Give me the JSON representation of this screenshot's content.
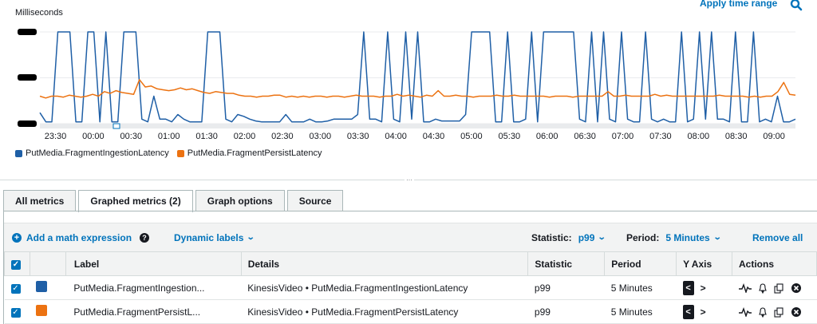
{
  "graph": {
    "y_title": "Milliseconds",
    "apply_time_range": "Apply time range",
    "x_ticks": [
      "23:30",
      "00:00",
      "00:30",
      "01:00",
      "01:30",
      "02:00",
      "02:30",
      "03:00",
      "03:30",
      "04:00",
      "04:30",
      "05:00",
      "05:30",
      "06:00",
      "06:30",
      "07:00",
      "07:30",
      "08:00",
      "08:30",
      "09:00"
    ],
    "accent_color": "#0073bb"
  },
  "chart_data": {
    "type": "line",
    "title": "",
    "ylabel": "Milliseconds",
    "xlabel": "",
    "ylim": [
      0,
      1
    ],
    "y_tick_labels_redacted": true,
    "x_tick_labels": [
      "23:30",
      "00:00",
      "00:30",
      "01:00",
      "01:30",
      "02:00",
      "02:30",
      "03:00",
      "03:30",
      "04:00",
      "04:30",
      "05:00",
      "05:30",
      "06:00",
      "06:30",
      "07:00",
      "07:30",
      "08:00",
      "08:30",
      "09:00"
    ],
    "grid": true,
    "legend_position": "bottom-left",
    "series": [
      {
        "name": "PutMedia.FragmentIngestionLatency",
        "color": "#1f5fa6",
        "values": [
          0.12,
          0.02,
          0.02,
          1.0,
          1.0,
          1.0,
          0.02,
          0.02,
          1.0,
          1.0,
          0.02,
          1.0,
          0.02,
          0.02,
          1.0,
          1.0,
          1.0,
          0.05,
          0.02,
          0.3,
          0.05,
          0.05,
          0.02,
          0.1,
          0.05,
          0.02,
          0.02,
          0.02,
          1.0,
          1.0,
          1.0,
          0.05,
          0.02,
          0.1,
          0.08,
          0.05,
          0.03,
          0.02,
          0.02,
          0.02,
          0.02,
          0.1,
          0.02,
          0.02,
          0.02,
          0.05,
          0.02,
          0.02,
          0.03,
          0.05,
          0.05,
          0.05,
          0.05,
          0.1,
          1.0,
          0.05,
          0.05,
          0.02,
          1.0,
          0.05,
          0.02,
          1.0,
          0.05,
          1.0,
          0.02,
          0.02,
          0.05,
          0.03,
          0.03,
          0.03,
          0.03,
          0.1,
          1.0,
          1.0,
          1.0,
          1.0,
          0.02,
          0.02,
          1.0,
          0.02,
          0.02,
          0.05,
          1.0,
          0.02,
          1.0,
          1.0,
          1.0,
          1.0,
          1.0,
          1.0,
          0.05,
          0.02,
          1.0,
          0.02,
          1.0,
          0.05,
          0.02,
          1.0,
          0.05,
          0.02,
          0.02,
          1.0,
          0.05,
          0.02,
          0.05,
          0.02,
          0.02,
          1.0,
          0.02,
          0.05,
          1.0,
          0.05,
          1.0,
          0.05,
          0.05,
          0.02,
          1.0,
          0.02,
          0.02,
          1.0,
          0.02,
          0.05,
          0.02,
          0.3,
          0.02,
          0.02,
          0.05
        ]
      },
      {
        "name": "PutMedia.FragmentPersistLatency",
        "color": "#ec7211",
        "values": [
          0.3,
          0.28,
          0.3,
          0.3,
          0.29,
          0.31,
          0.3,
          0.29,
          0.3,
          0.32,
          0.3,
          0.35,
          0.33,
          0.36,
          0.34,
          0.33,
          0.32,
          0.48,
          0.4,
          0.41,
          0.38,
          0.37,
          0.36,
          0.37,
          0.39,
          0.37,
          0.38,
          0.36,
          0.34,
          0.33,
          0.35,
          0.34,
          0.33,
          0.33,
          0.31,
          0.3,
          0.3,
          0.29,
          0.3,
          0.3,
          0.31,
          0.31,
          0.29,
          0.3,
          0.29,
          0.3,
          0.29,
          0.3,
          0.3,
          0.29,
          0.3,
          0.3,
          0.29,
          0.3,
          0.31,
          0.3,
          0.3,
          0.3,
          0.29,
          0.3,
          0.3,
          0.32,
          0.3,
          0.31,
          0.3,
          0.29,
          0.31,
          0.3,
          0.36,
          0.3,
          0.3,
          0.31,
          0.3,
          0.3,
          0.29,
          0.3,
          0.3,
          0.3,
          0.31,
          0.3,
          0.3,
          0.31,
          0.3,
          0.3,
          0.3,
          0.3,
          0.3,
          0.29,
          0.3,
          0.3,
          0.3,
          0.29,
          0.3,
          0.3,
          0.3,
          0.3,
          0.3,
          0.35,
          0.3,
          0.3,
          0.31,
          0.3,
          0.3,
          0.3,
          0.3,
          0.32,
          0.3,
          0.31,
          0.3,
          0.3,
          0.3,
          0.3,
          0.3,
          0.3,
          0.3,
          0.3,
          0.31,
          0.3,
          0.3,
          0.3,
          0.3,
          0.29,
          0.3,
          0.29,
          0.3,
          0.3,
          0.35,
          0.45,
          0.32,
          0.31
        ]
      }
    ]
  },
  "legend": [
    {
      "label": "PutMedia.FragmentIngestionLatency",
      "color": "#1f5fa6"
    },
    {
      "label": "PutMedia.FragmentPersistLatency",
      "color": "#ec7211"
    }
  ],
  "tabs": [
    {
      "label": "All metrics",
      "active": false
    },
    {
      "label": "Graphed metrics (2)",
      "active": true
    },
    {
      "label": "Graph options",
      "active": false
    },
    {
      "label": "Source",
      "active": false
    }
  ],
  "toolbar": {
    "add_math": "Add a math expression",
    "dynamic_labels": "Dynamic labels",
    "statistic_label": "Statistic:",
    "statistic_value": "p99",
    "period_label": "Period:",
    "period_value": "5 Minutes",
    "remove_all": "Remove all"
  },
  "table": {
    "headers": {
      "label": "Label",
      "details": "Details",
      "statistic": "Statistic",
      "period": "Period",
      "y_axis": "Y Axis",
      "actions": "Actions"
    },
    "rows": [
      {
        "color": "#1f5fa6",
        "label": "PutMedia.FragmentIngestion...",
        "namespace": "KinesisVideo",
        "metric": "PutMedia.FragmentIngestionLatency",
        "statistic": "p99",
        "period": "5 Minutes"
      },
      {
        "color": "#ec7211",
        "label": "PutMedia.FragmentPersistL...",
        "namespace": "KinesisVideo",
        "metric": "PutMedia.FragmentPersistLatency",
        "statistic": "p99",
        "period": "5 Minutes"
      }
    ]
  }
}
